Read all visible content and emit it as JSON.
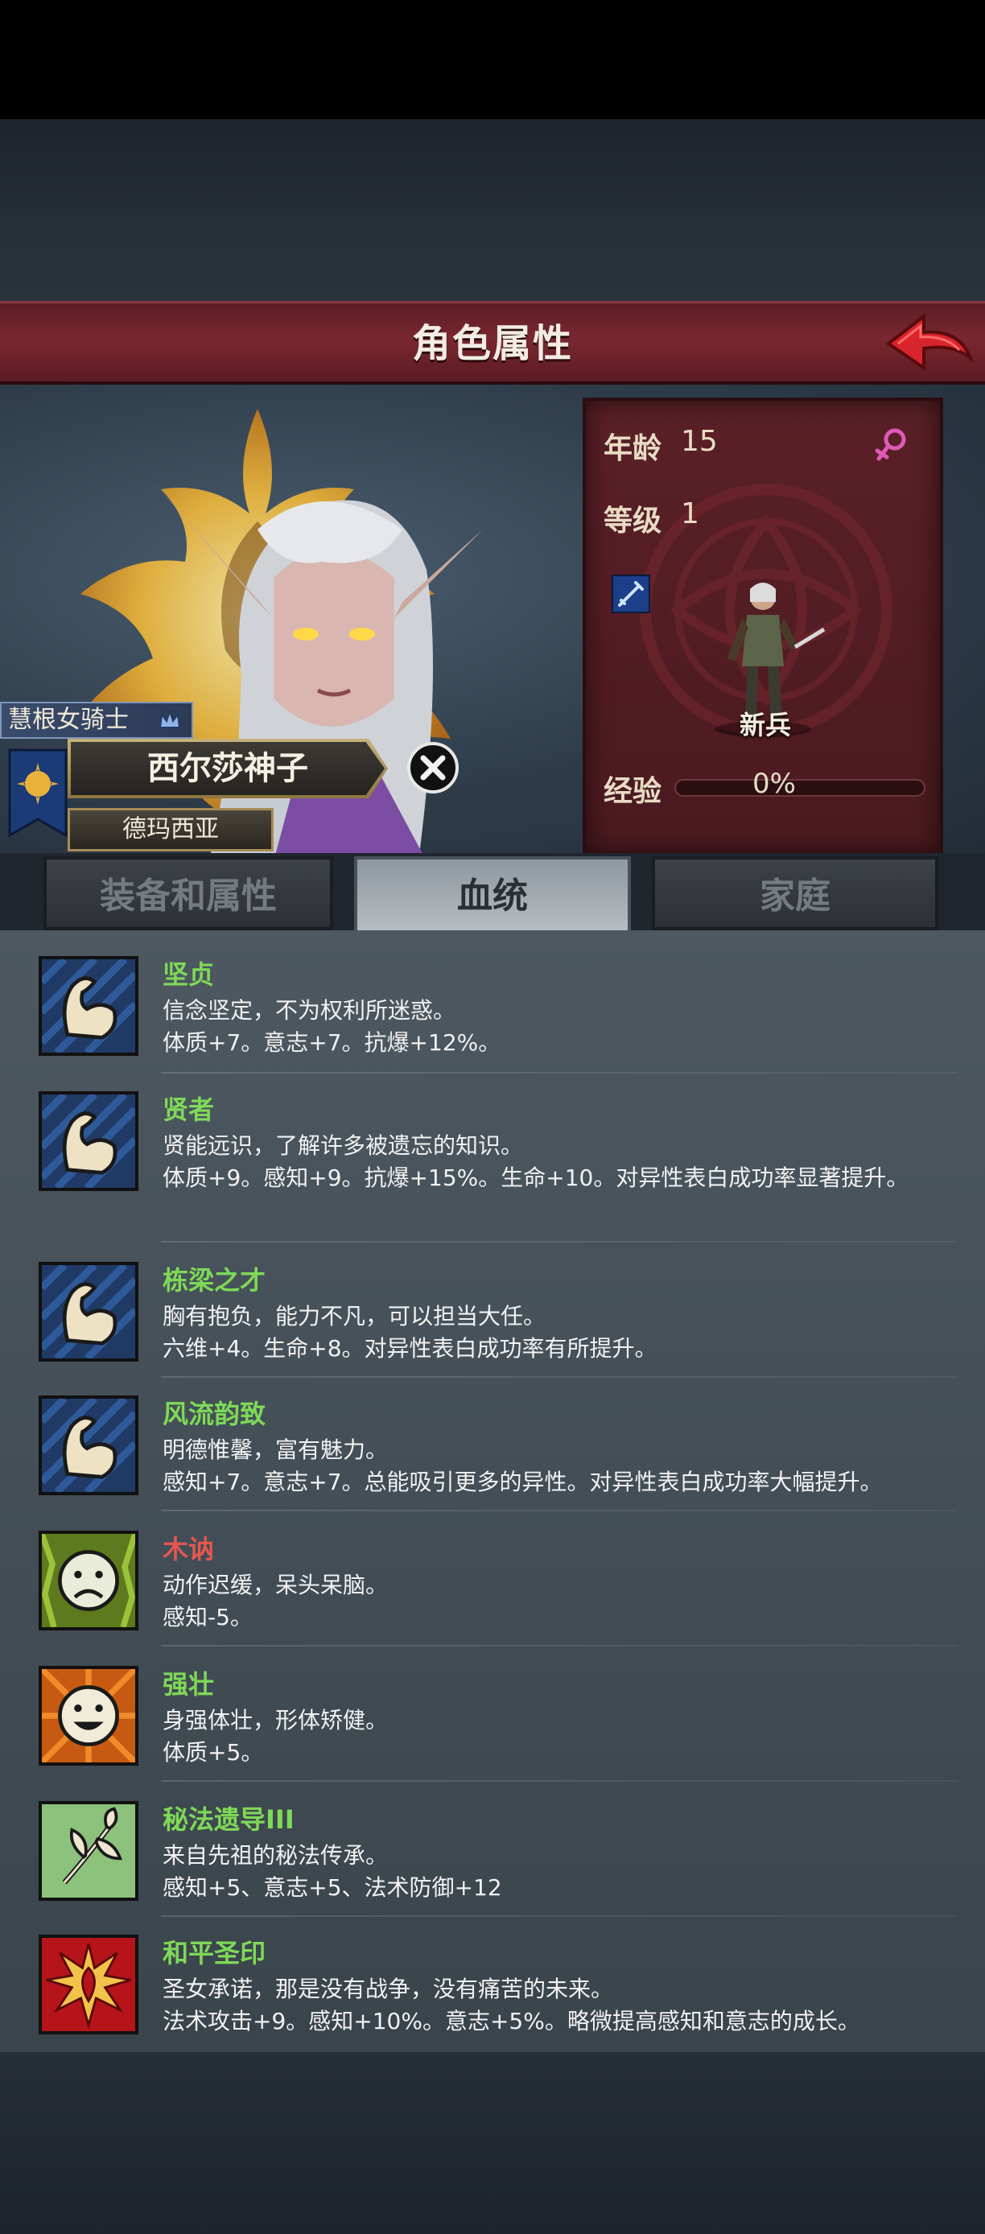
{
  "header": {
    "title": "角色属性",
    "back_icon": "back-arrow-icon"
  },
  "character": {
    "class_title": "慧根女骑士",
    "name": "西尔莎神子",
    "region": "德玛西亚",
    "age_label": "年龄",
    "age_value": "15",
    "level_label": "等级",
    "level_value": "1",
    "unit_name": "新兵",
    "exp_label": "经验",
    "exp_value": "0%",
    "exp_fraction": 0
  },
  "tabs": [
    {
      "label": "装备和属性",
      "active": false
    },
    {
      "label": "血统",
      "active": true
    },
    {
      "label": "家庭",
      "active": false
    }
  ],
  "colors": {
    "positive": "#7ed957",
    "negative": "#e5574f",
    "accent": "#7a2730"
  },
  "traits": [
    {
      "name": "坚贞",
      "tone": "positive",
      "icon": "flexed-arm-icon",
      "desc": "信念坚定，不为权利所迷惑。",
      "effect": "体质+7。意志+7。抗爆+12%。"
    },
    {
      "name": "贤者",
      "tone": "positive",
      "icon": "flexed-arm-icon",
      "desc": "贤能远识，了解许多被遗忘的知识。",
      "effect": "体质+9。感知+9。抗爆+15%。生命+10。对异性表白成功率显著提升。"
    },
    {
      "name": "栋梁之才",
      "tone": "positive",
      "icon": "flexed-arm-icon",
      "desc": "胸有抱负，能力不凡，可以担当大任。",
      "effect": "六维+4。生命+8。对异性表白成功率有所提升。"
    },
    {
      "name": "风流韵致",
      "tone": "positive",
      "icon": "flexed-arm-icon",
      "desc": "明德惟馨，富有魅力。",
      "effect": "感知+7。意志+7。总能吸引更多的异性。对异性表白成功率大幅提升。"
    },
    {
      "name": "木讷",
      "tone": "negative",
      "icon": "sad-face-icon",
      "desc": "动作迟缓，呆头呆脑。",
      "effect": "感知-5。"
    },
    {
      "name": "强壮",
      "tone": "positive",
      "icon": "happy-face-icon",
      "desc": "身强体壮，形体矫健。",
      "effect": "体质+5。"
    },
    {
      "name": "秘法遗导III",
      "tone": "positive",
      "icon": "leaf-branch-icon",
      "desc": "来自先祖的秘法传承。",
      "effect": "感知+5、意志+5、法术防御+12"
    },
    {
      "name": "和平圣印",
      "tone": "positive",
      "icon": "holy-sigil-icon",
      "desc": "圣女承诺，那是没有战争，没有痛苦的未来。",
      "effect": "法术攻击+9。感知+10%。意志+5%。略微提高感知和意志的成长。"
    }
  ]
}
